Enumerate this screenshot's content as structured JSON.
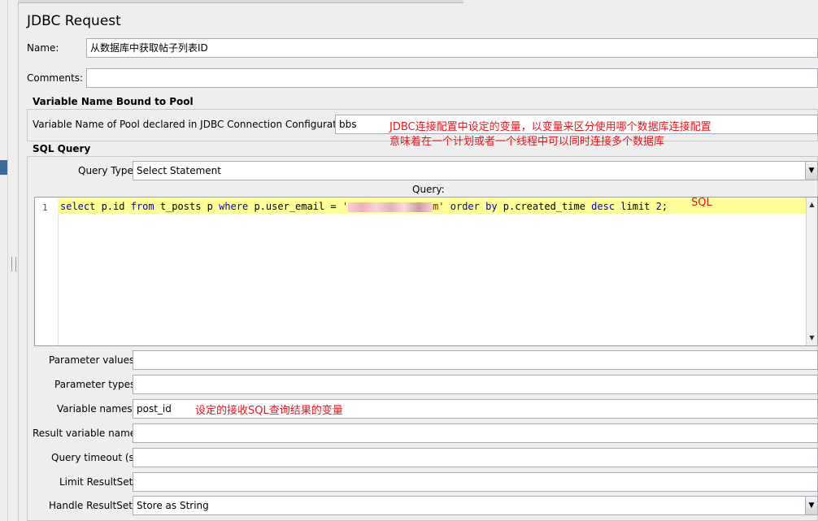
{
  "title": "JDBC Request",
  "name_label": "Name:",
  "name_value": "从数据库中获取帖子列表ID",
  "comments_label": "Comments:",
  "comments_value": "",
  "pool_section": "Variable Name Bound to Pool",
  "pool_label": "Variable Name of Pool declared in JDBC Connection Configuration:",
  "pool_value": "bbs",
  "pool_note_1": "JDBC连接配置中设定的变量，以变量来区分使用哪个数据库连接配置",
  "pool_note_2": "意味着在一个计划或者一个线程中可以同时连接多个数据库",
  "sql_section": "SQL Query",
  "query_type_label": "Query Type:",
  "query_type_value": "Select Statement",
  "query_label": "Query:",
  "line_number": "1",
  "sql": {
    "kw_select": "select",
    "t1": " p.id ",
    "kw_from": "from",
    "t2": " t_posts p ",
    "kw_where": "where",
    "t3": " p.user_email = ",
    "quote_open": "'",
    "quote_close": "m'",
    "t4": " ",
    "kw_order": "order",
    "t5": " ",
    "kw_by": "by",
    "t6": " p.created_time ",
    "kw_desc": "desc",
    "t7": " limit ",
    "limit_value": "2",
    "end": ";"
  },
  "sql_note": "SQL",
  "param_values_label": "Parameter values:",
  "param_values_value": "",
  "param_types_label": "Parameter types:",
  "param_types_value": "",
  "var_names_label": "Variable names:",
  "var_names_value": "post_id",
  "var_names_note": "设定的接收SQL查询结果的变量",
  "result_var_label": "Result variable name:",
  "result_var_value": "",
  "timeout_label": "Query timeout (s):",
  "timeout_value": "",
  "limit_label": "Limit ResultSet:",
  "limit_value": "",
  "handle_label": "Handle ResultSet:",
  "handle_value": "Store as String",
  "colors": {
    "note": "#e8141c",
    "keyword": "#0000c8",
    "highlight": "#ffff99"
  }
}
